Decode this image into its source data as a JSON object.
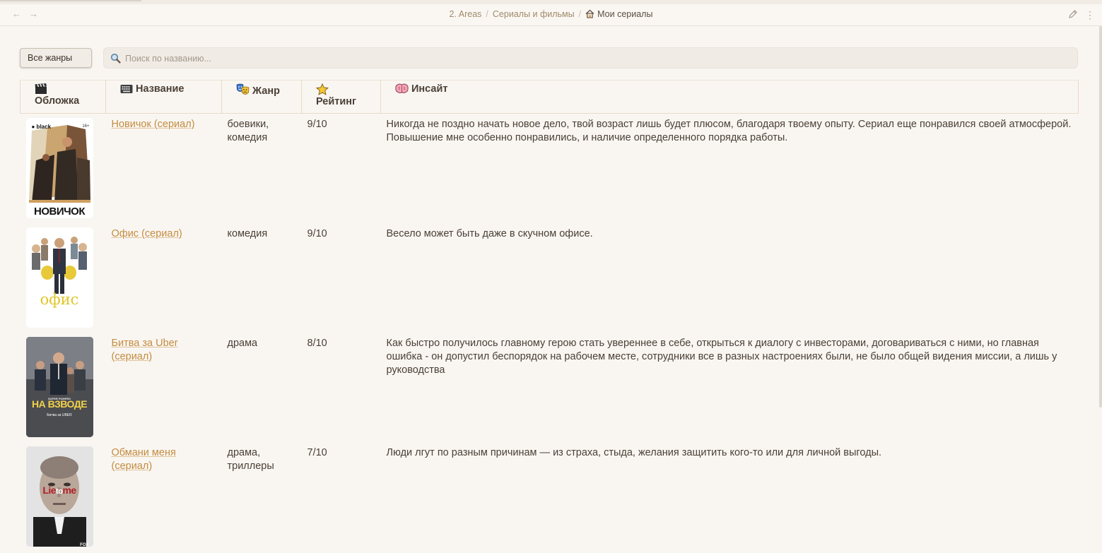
{
  "breadcrumb": {
    "items": [
      "2. Areas",
      "Сериалы и фильмы"
    ],
    "separator": "/",
    "current": "Мои сериалы"
  },
  "toolbar": {
    "genre_button": "Все жанры",
    "search_placeholder": "Поиск по названию..."
  },
  "columns": {
    "cover": "Обложка",
    "title": "Название",
    "genre": "Жанр",
    "rating": "Рейтинг",
    "insight": "Инсайт"
  },
  "rows": [
    {
      "title": "Новичок (сериал)",
      "genre": "боевики, комедия",
      "rating": "9/10",
      "insight": "Никогда не поздно начать новое дело, твой возраст лишь будет плюсом, благодаря твоему опыту. Сериал еще понравился своей атмосферой. Повышение мне особенно понравились, и наличие определенного порядка работы.",
      "poster": {
        "brand": "● black",
        "age": "16+",
        "caption": "НОВИЧОК"
      }
    },
    {
      "title": "Офис (сериал)",
      "genre": "комедия",
      "rating": "9/10",
      "insight": "Весело может быть даже в скучном офисе.",
      "poster": {
        "caption": "офис"
      }
    },
    {
      "title": "Битва за Uber (сериал)",
      "genre": "драма",
      "rating": "8/10",
      "insight": "Как быстро получилось главному герою стать увереннее в себе, открыться к диалогу с инвесторами, договариваться с ними, но главная ошибка - он допустил беспорядок на рабочем месте, сотрудники все в разных настроениях были, не было общей видения миссии, а лишь у руководства",
      "poster": {
        "tag": "SUPER PUMPED",
        "caption": "НА ВЗВОДЕ",
        "sub": "Битва за UBER"
      }
    },
    {
      "title": "Обмани меня (сериал)",
      "genre": "драма, триллеры",
      "rating": "7/10",
      "insight": "Люди лгут по разным причинам — из страха, стыда, желания защитить кого-то или для личной выгоды.",
      "poster": {
        "caption_a": "Lie",
        "caption_b": "to",
        "caption_c": "me",
        "network": "FOX"
      }
    }
  ],
  "colors": {
    "background": "#f9f6f2",
    "link": "#c48c3e",
    "text": "#4a3f35",
    "border": "#e8d9c5"
  }
}
